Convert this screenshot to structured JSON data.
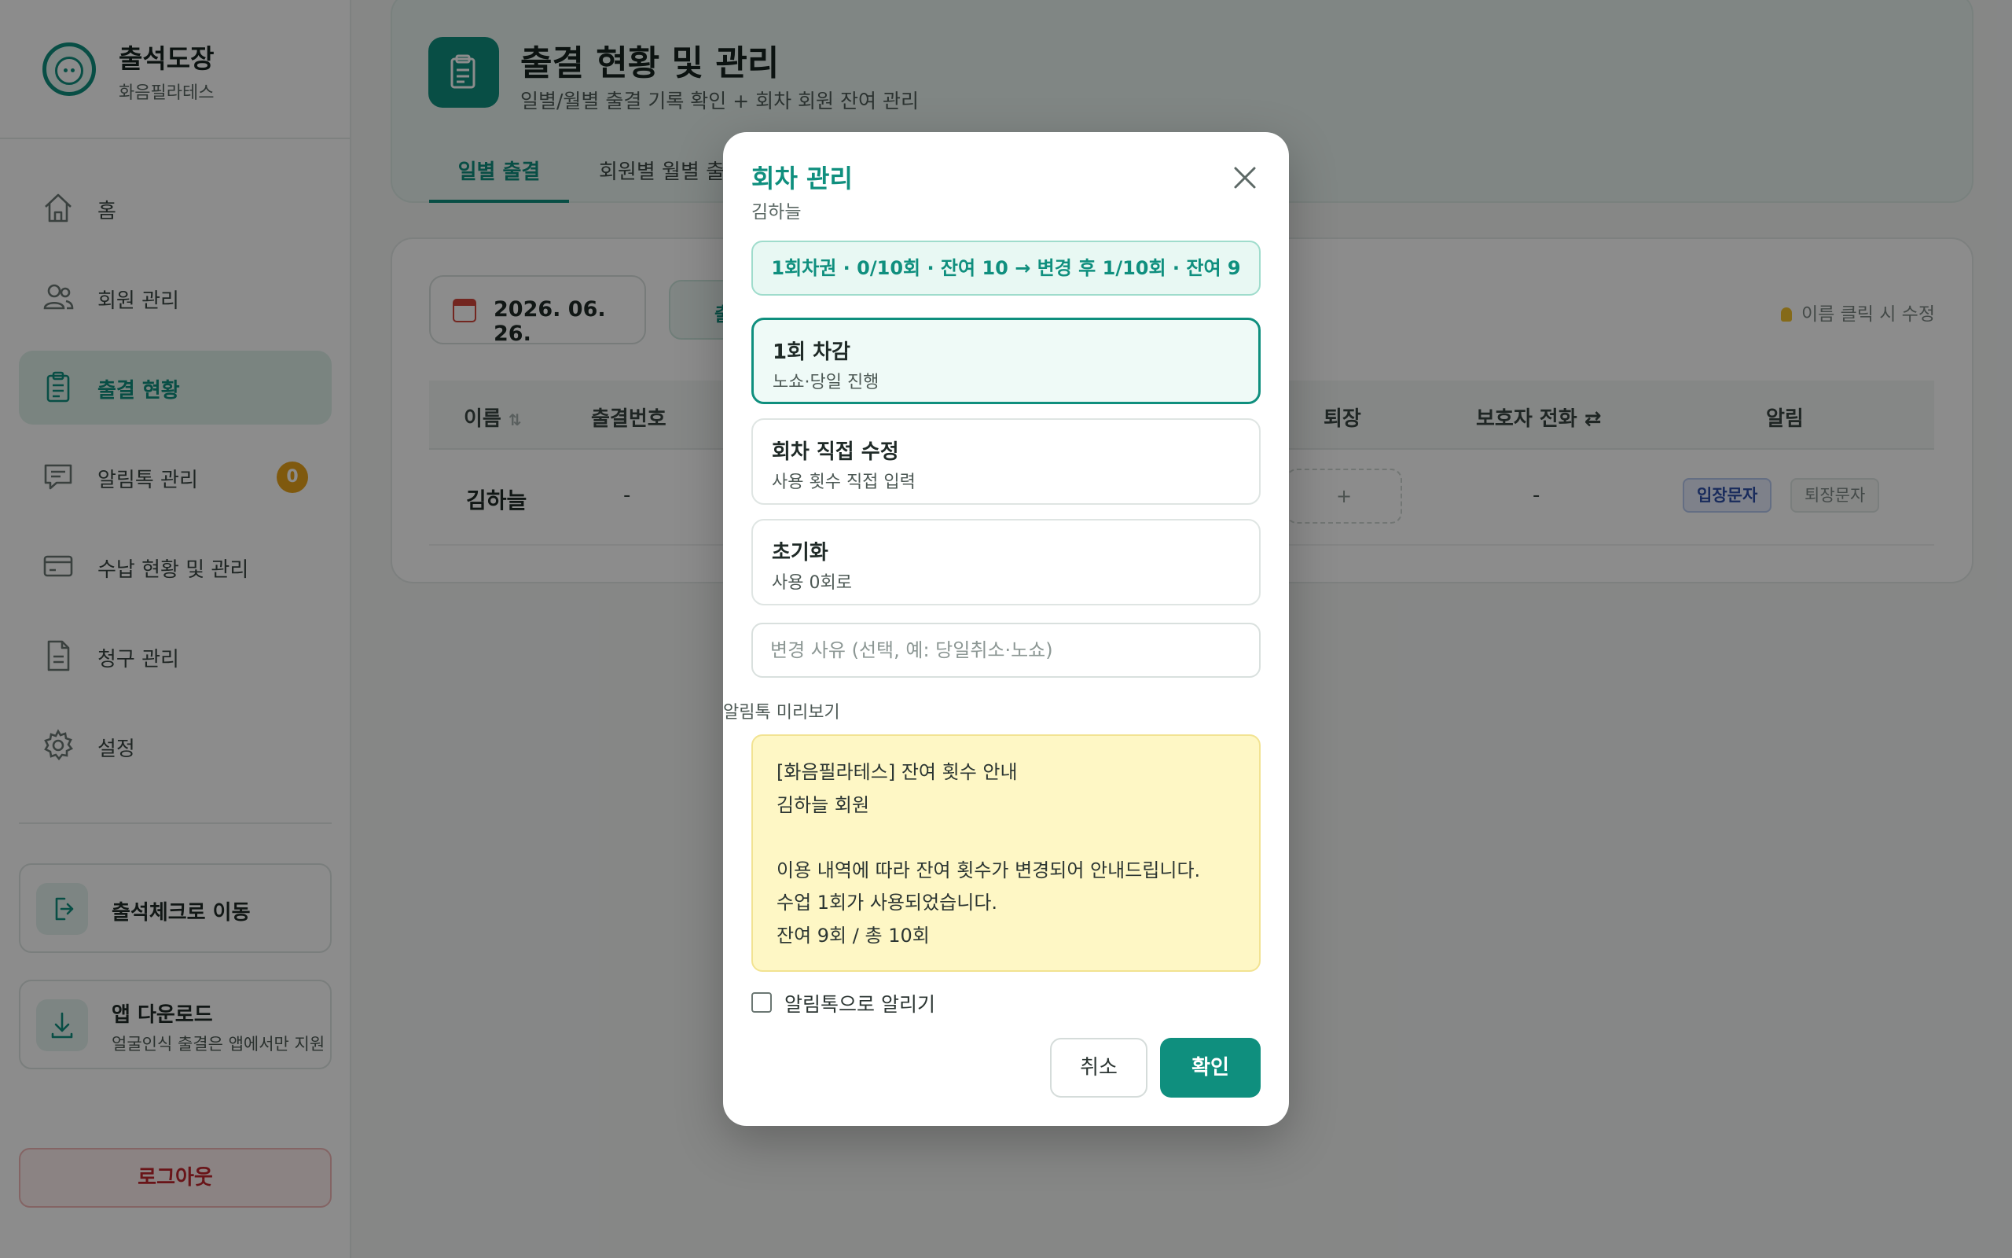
{
  "brand": {
    "name": "출석도장",
    "subtitle": "화음필라테스"
  },
  "sidebar": {
    "items": [
      {
        "label": "홈",
        "icon": "home-icon"
      },
      {
        "label": "회원 관리",
        "icon": "users-icon"
      },
      {
        "label": "출결 현황",
        "icon": "clipboard-icon",
        "active": true
      },
      {
        "label": "알림톡 관리",
        "icon": "chat-icon",
        "badge": "0"
      },
      {
        "label": "수납 현황 및 관리",
        "icon": "card-icon"
      },
      {
        "label": "청구 관리",
        "icon": "document-icon"
      },
      {
        "label": "설정",
        "icon": "gear-icon"
      }
    ],
    "checkin": {
      "label": "출석체크로 이동",
      "icon": "login-icon"
    },
    "app": {
      "title": "앱 다운로드",
      "subtitle": "얼굴인식 출결은 앱에서만 지원",
      "icon": "download-icon"
    },
    "logout": "로그아웃"
  },
  "header": {
    "title": "출결 현황 및 관리",
    "subtitle": "일별/월별 출결 기록 확인 + 회차 회원 잔여 관리",
    "tabs": [
      "일별 출결",
      "회원별 월별 출결"
    ]
  },
  "toolbar": {
    "date": "2026. 06. 26.",
    "chip": "출",
    "hint": "이름 클릭 시 수정"
  },
  "table": {
    "headers": {
      "name": "이름",
      "number": "출결번호",
      "exit": "퇴장",
      "guardian": "보호자 전화",
      "notify": "알림"
    },
    "row": {
      "name": "김하늘",
      "number": "-",
      "exit": "+",
      "guardian": "-",
      "in_label": "입장문자",
      "out_label": "퇴장문자"
    }
  },
  "modal": {
    "title": "회차 관리",
    "member": "김하늘",
    "summary": "1회차권 · 0/10회 · 잔여 10 → 변경 후 1/10회 · 잔여 9",
    "options": [
      {
        "title": "1회 차감",
        "desc": "노쇼·당일 진행"
      },
      {
        "title": "회차 직접 수정",
        "desc": "사용 횟수 직접 입력"
      },
      {
        "title": "초기화",
        "desc": "사용 0회로"
      }
    ],
    "reason_placeholder": "변경 사유 (선택, 예: 당일취소·노쇼)",
    "preview_label": "알림톡 미리보기",
    "preview_lines": [
      "[화음필라테스] 잔여 횟수 안내",
      "김하늘 회원",
      "",
      "이용 내역에 따라 잔여 횟수가 변경되어 안내드립니다.",
      "수업 1회가 사용되었습니다.",
      "잔여 9회 / 총 10회"
    ],
    "notify_label": "알림톡으로 알리기",
    "cancel": "취소",
    "confirm": "확인"
  },
  "colors": {
    "accent": "#0f8f7e",
    "badge": "#e8a21a",
    "preview_bg": "#fef7c5",
    "logout": "#c0262d"
  }
}
